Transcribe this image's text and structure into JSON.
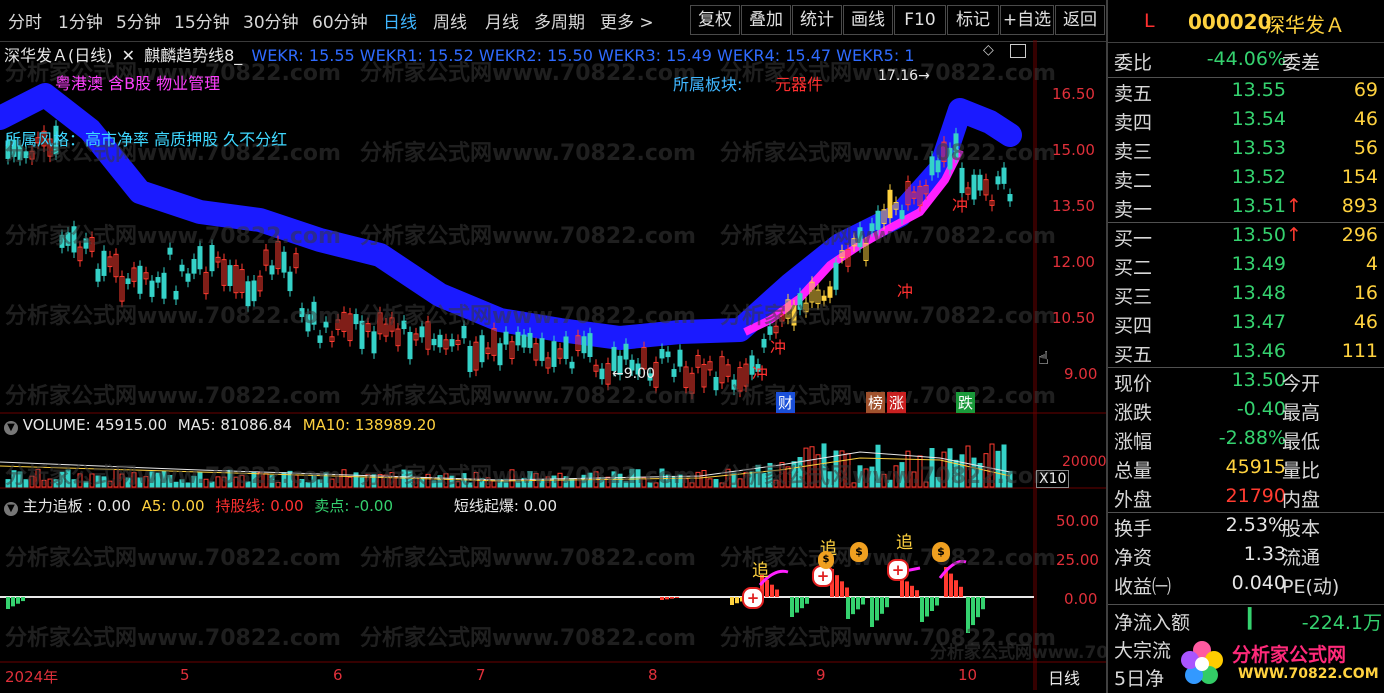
{
  "toolbar": {
    "periods": [
      "分时",
      "1分钟",
      "5分钟",
      "15分钟",
      "30分钟",
      "60分钟",
      "日线",
      "周线",
      "月线",
      "多周期",
      "更多 >"
    ],
    "active_period": "日线",
    "buttons": [
      "复权",
      "叠加",
      "统计",
      "画线",
      "F10",
      "标记",
      "+自选",
      "返回"
    ]
  },
  "chart_header": {
    "stock_name": "深华发Ａ(日线)",
    "indicator_name": "麒麟趋势线8_",
    "wekr": "WEKR: 15.55 WEKR1: 15.52 WEKR2: 15.50 WEKR3: 15.49 WEKR4: 15.47 WEKR5: 1"
  },
  "info_tags": {
    "concepts": "粤港澳 含B股 物业管理",
    "sector_label": "所属板块:",
    "sector_value": "元器件",
    "style": "所属风格：高市净率 高质押股 久不分红",
    "high_marker": "17.16",
    "low_marker": "9.00"
  },
  "price_axis": [
    "16.50",
    "15.00",
    "13.50",
    "12.00",
    "10.50",
    "9.00"
  ],
  "event_tags": [
    "财",
    "榜",
    "涨",
    "跌"
  ],
  "chong_labels": [
    "冲",
    "冲",
    "冲",
    "冲"
  ],
  "volume_header": {
    "volume": "VOLUME: 45915.00",
    "ma5": "MA5: 81086.84",
    "ma10": "MA10: 138989.20"
  },
  "volume_axis": {
    "tick": "20000",
    "unit": "X10"
  },
  "indicator_header": {
    "name": "主力追板 : 0.00",
    "a5": "A5: 0.00",
    "hold": "持股线: 0.00",
    "sell": "卖点: -0.00",
    "burst": "短线起爆: 0.00"
  },
  "indicator_axis": [
    "50.00",
    "25.00",
    "0.00"
  ],
  "indicator_marks": [
    "追",
    "追",
    "追"
  ],
  "time_axis": [
    "2024年",
    "5",
    "6",
    "7",
    "8",
    "9",
    "10"
  ],
  "period_tab": "日线",
  "watermark": [
    "分析家公式网www.70822.com"
  ],
  "logo": {
    "text": "分析家公式网",
    "url": "WWW.70822.COM"
  },
  "panel": {
    "code": "000020",
    "name": "深华发Ａ",
    "flag": "L",
    "weibi_label": "委比",
    "weibi_value": "-44.06%",
    "weicha_label": "委差",
    "sells": [
      {
        "label": "卖五",
        "price": "13.55",
        "vol": "69",
        "arrow": ""
      },
      {
        "label": "卖四",
        "price": "13.54",
        "vol": "46",
        "arrow": ""
      },
      {
        "label": "卖三",
        "price": "13.53",
        "vol": "56",
        "arrow": ""
      },
      {
        "label": "卖二",
        "price": "13.52",
        "vol": "154",
        "arrow": ""
      },
      {
        "label": "卖一",
        "price": "13.51",
        "vol": "893",
        "arrow": "↑"
      }
    ],
    "buys": [
      {
        "label": "买一",
        "price": "13.50",
        "vol": "296",
        "arrow": "↑"
      },
      {
        "label": "买二",
        "price": "13.49",
        "vol": "4",
        "arrow": ""
      },
      {
        "label": "买三",
        "price": "13.48",
        "vol": "16",
        "arrow": ""
      },
      {
        "label": "买四",
        "price": "13.47",
        "vol": "46",
        "arrow": ""
      },
      {
        "label": "买五",
        "price": "13.46",
        "vol": "111",
        "arrow": ""
      }
    ],
    "stats": [
      {
        "label": "现价",
        "value": "13.50",
        "cls": "green",
        "label2": "今开"
      },
      {
        "label": "涨跌",
        "value": "-0.40",
        "cls": "green",
        "label2": "最高"
      },
      {
        "label": "涨幅",
        "value": "-2.88%",
        "cls": "green",
        "label2": "最低"
      },
      {
        "label": "总量",
        "value": "45915",
        "cls": "yellow",
        "label2": "量比"
      },
      {
        "label": "外盘",
        "value": "21790",
        "cls": "red",
        "label2": "内盘"
      }
    ],
    "stats2": [
      {
        "label": "换手",
        "value": "2.53%",
        "cls": "white",
        "label2": "股本"
      },
      {
        "label": "净资",
        "value": "1.33",
        "cls": "white",
        "label2": "流通"
      },
      {
        "label": "收益㈠",
        "value": "0.040",
        "cls": "white",
        "label2": "PE(动)"
      }
    ],
    "netflow_label": "净流入额",
    "netflow_value": "-224.1万",
    "bigdeal_label": "大宗流",
    "fiveday_label": "5日净"
  },
  "colors": {
    "up": "#ff3b30",
    "down": "#35d2c8",
    "trend_band": "#1a1aff",
    "ma_pink": "#ff20ff",
    "yellow": "#ffd23f"
  }
}
